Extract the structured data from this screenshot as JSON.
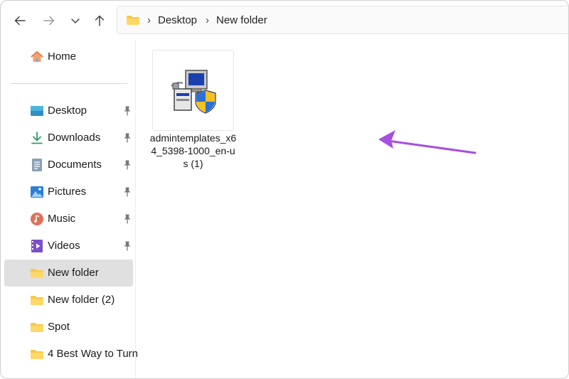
{
  "toolbar": {
    "back_icon": "arrow-left-icon",
    "forward_icon": "arrow-right-icon",
    "recent_icon": "chevron-down-icon",
    "up_icon": "arrow-up-icon"
  },
  "address_bar": {
    "folder_icon": "folder-icon",
    "breadcrumbs": [
      "Desktop",
      "New folder"
    ]
  },
  "sidebar": {
    "items": [
      {
        "label": "Home",
        "icon": "home-icon",
        "pinned": false
      },
      {
        "label": "Desktop",
        "icon": "desktop-icon",
        "pinned": true
      },
      {
        "label": "Downloads",
        "icon": "download-icon",
        "pinned": true
      },
      {
        "label": "Documents",
        "icon": "documents-icon",
        "pinned": true
      },
      {
        "label": "Pictures",
        "icon": "pictures-icon",
        "pinned": true
      },
      {
        "label": "Music",
        "icon": "music-icon",
        "pinned": true
      },
      {
        "label": "Videos",
        "icon": "videos-icon",
        "pinned": true
      },
      {
        "label": "New folder",
        "icon": "folder-icon",
        "pinned": false,
        "selected": true
      },
      {
        "label": "New folder (2)",
        "icon": "folder-icon",
        "pinned": false
      },
      {
        "label": "Spot",
        "icon": "folder-icon",
        "pinned": false
      },
      {
        "label": "4 Best Way to Turn",
        "icon": "folder-icon",
        "pinned": false
      }
    ]
  },
  "files": [
    {
      "name": "admintemplates_x64_5398-1000_en-us (1)",
      "icon": "installer-icon"
    }
  ],
  "annotation": {
    "icon": "pointer-arrow-icon",
    "color": "#a74fe0"
  },
  "colors": {
    "folder": "#f7c948",
    "selected_bg": "#e0e0e0",
    "accent_arrow": "#a74fe0"
  }
}
